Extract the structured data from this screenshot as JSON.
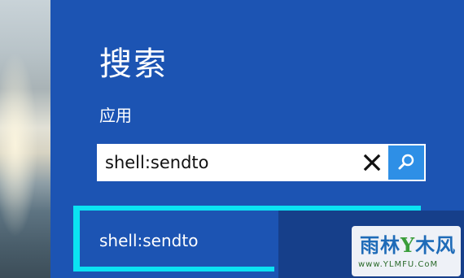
{
  "charm": {
    "title": "搜索",
    "scope": "应用"
  },
  "search": {
    "value": "shell:sendto",
    "clear_icon": "close-icon",
    "search_icon": "search-icon"
  },
  "results": [
    {
      "label": "shell:sendto"
    }
  ],
  "watermark": {
    "logo_text": "雨林木风",
    "url": "www.YLMFU.CoM"
  },
  "colors": {
    "panel": "#1c54b3",
    "focus_outline": "#0be3f2",
    "search_button": "#2e8fe6"
  }
}
